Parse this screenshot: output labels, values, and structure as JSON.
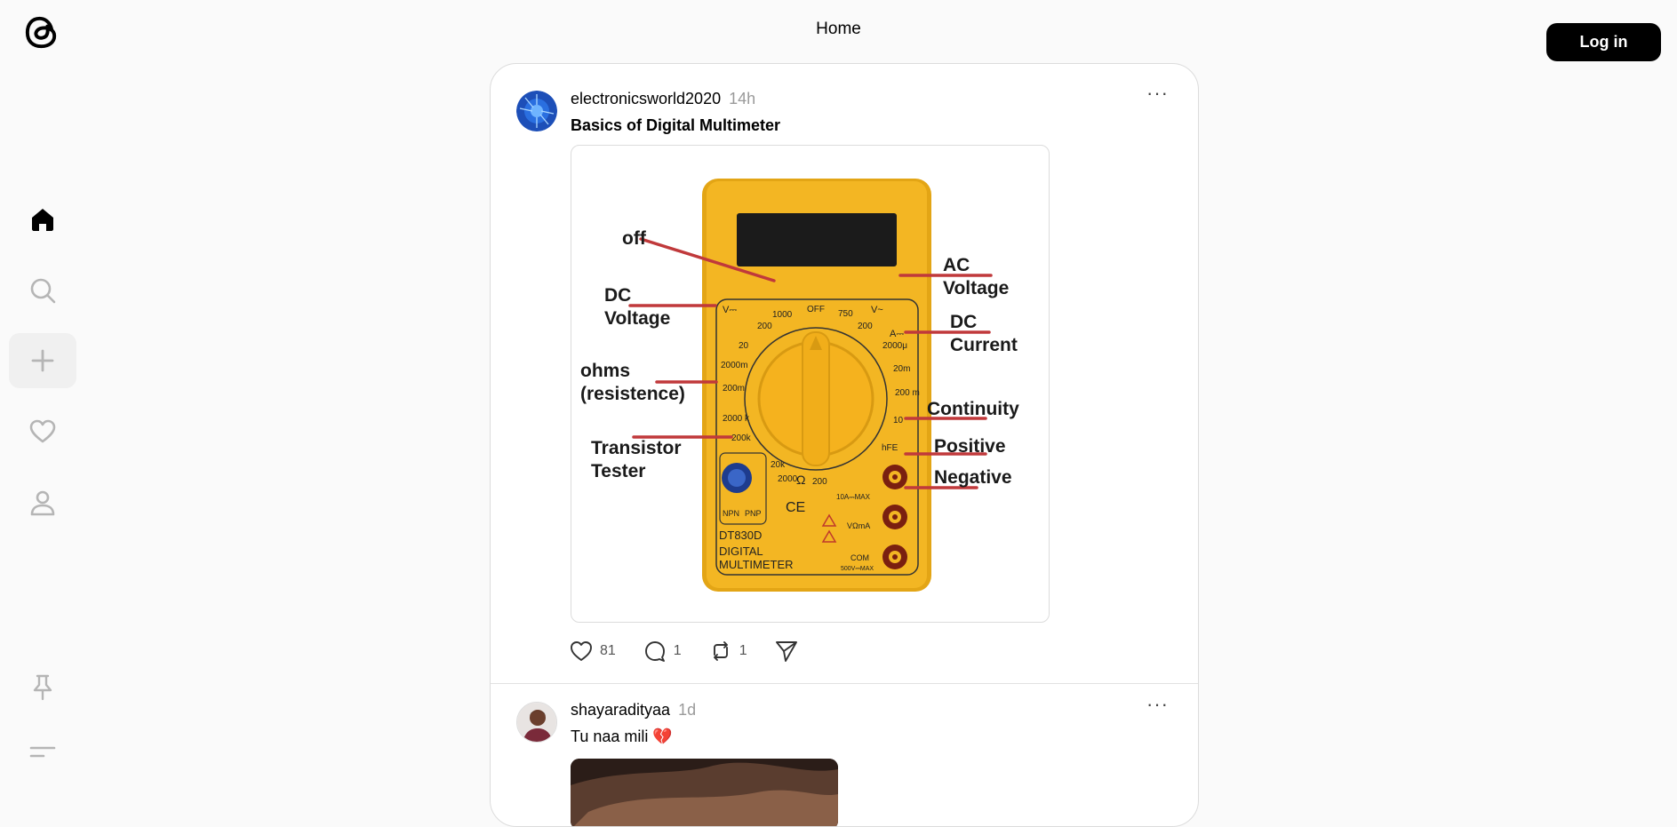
{
  "header": {
    "title": "Home",
    "login_label": "Log in"
  },
  "sidebar": {
    "items": [
      {
        "name": "home",
        "icon": "home-icon",
        "active": true
      },
      {
        "name": "search",
        "icon": "search-icon",
        "active": false
      },
      {
        "name": "create",
        "icon": "plus-icon",
        "active": false
      },
      {
        "name": "activity",
        "icon": "heart-icon",
        "active": false
      },
      {
        "name": "profile",
        "icon": "user-icon",
        "active": false
      }
    ],
    "bottom_items": [
      {
        "name": "pinned",
        "icon": "pin-icon"
      },
      {
        "name": "menu",
        "icon": "menu-icon"
      }
    ]
  },
  "posts": [
    {
      "username": "electronicsworld2020",
      "time": "14h",
      "text": "Basics of Digital Multimeter",
      "image": {
        "labels": {
          "off": "off",
          "dc_voltage_1": "DC",
          "dc_voltage_2": "Voltage",
          "ohms_1": "ohms",
          "ohms_2": "(resistence)",
          "transistor_1": "Transistor",
          "transistor_2": "Tester",
          "ac_voltage_1": "AC",
          "ac_voltage_2": "Voltage",
          "dc_current_1": "DC",
          "dc_current_2": "Current",
          "continuity": "Continuity",
          "positive": "Positive",
          "negative": "Negative"
        },
        "dial": {
          "v_dc": "V⎓",
          "v_ac": "V~",
          "a": "A⎓",
          "off": "OFF",
          "v1000": "1000",
          "v200a": "200",
          "v20": "20",
          "v2000m": "2000m",
          "v200m": "200m",
          "r2000k": "2000 k",
          "r200k": "200k",
          "r20k": "20k",
          "r2000": "2000",
          "omega": "Ω",
          "r200": "200",
          "ac750": "750",
          "ac200": "200",
          "a2000u": "2000μ",
          "a20m": "20m",
          "a200m": "200 m",
          "a10": "10",
          "hfe": "hFE",
          "npn": "NPN",
          "pnp": "PNP",
          "ce": "CE",
          "model": "DT830D",
          "line1": "DIGITAL",
          "line2": "MULTIMETER",
          "max10a": "10A⎓MAX",
          "vma": "VΩmA",
          "com": "COM",
          "max500": "500V⎓MAX"
        }
      },
      "likes": "81",
      "replies": "1",
      "reposts": "1"
    },
    {
      "username": "shayaradityaa",
      "time": "1d",
      "text": "Tu naa mili 💔"
    }
  ],
  "colors": {
    "background": "#fafafa",
    "card": "#ffffff",
    "meter_yellow": "#f3b623",
    "label_line": "#c0393b"
  }
}
